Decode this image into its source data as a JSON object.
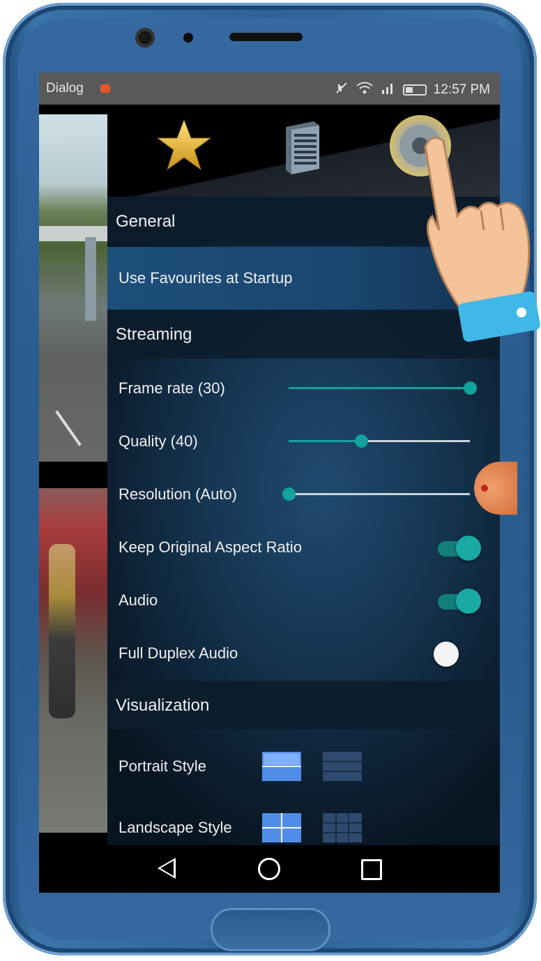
{
  "status_bar": {
    "app_name": "Dialog",
    "time": "12:57 PM"
  },
  "toolbar": {
    "icons": [
      "star-icon",
      "server-icon",
      "gear-icon"
    ]
  },
  "sections": {
    "general": "General",
    "streaming": "Streaming",
    "visualization": "Visualization"
  },
  "settings": {
    "use_favourites": {
      "label": "Use Favourites at Startup"
    },
    "frame_rate": {
      "label": "Frame rate (30)",
      "value_fraction": 1.0
    },
    "quality": {
      "label": "Quality (40)",
      "value_fraction": 0.4
    },
    "resolution": {
      "label": "Resolution (Auto)",
      "value_fraction": 0.0
    },
    "keep_aspect": {
      "label": "Keep Original Aspect Ratio",
      "on": true
    },
    "audio": {
      "label": "Audio",
      "on": true
    },
    "full_duplex": {
      "label": "Full Duplex Audio",
      "on": false
    },
    "portrait_style": {
      "label": "Portrait Style",
      "selected": 0
    },
    "landscape_style": {
      "label": "Landscape Style",
      "selected": 0
    }
  },
  "colors": {
    "accent": "#12a39c",
    "phone_body": "#2e6296",
    "panel": "#153450"
  }
}
